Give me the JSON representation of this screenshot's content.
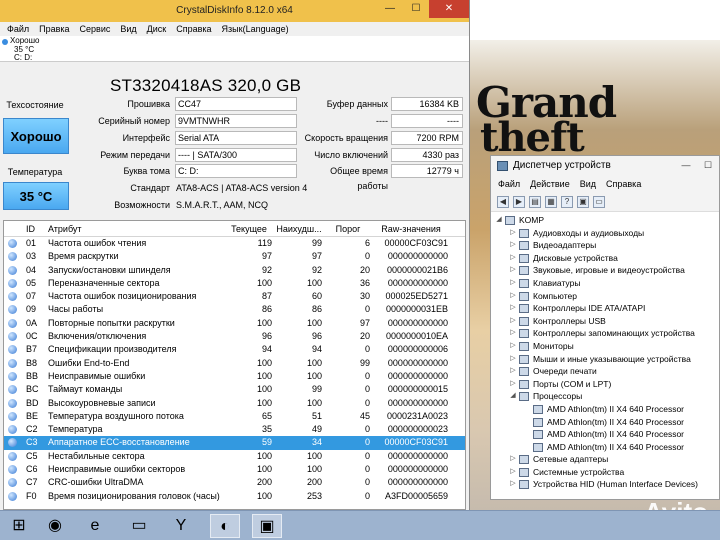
{
  "cdi": {
    "title": "CrystalDiskInfo 8.12.0 x64",
    "window_btns": {
      "min": "—",
      "max": "☐",
      "close": "✕"
    },
    "menu": [
      "Файл",
      "Правка",
      "Сервис",
      "Вид",
      "Диск",
      "Справка",
      "Язык(Language)"
    ],
    "drive_tab": {
      "status": "Хорошо",
      "temp": "35 °C",
      "letters": "C: D:"
    },
    "model": "ST3320418AS 320,0 GB",
    "health_label": "Техсостояние",
    "health_value": "Хорошо",
    "temp_label": "Температура",
    "temp_value": "35 °C",
    "info_left": [
      {
        "k": "Прошивка",
        "v": "CC47"
      },
      {
        "k": "Серийный номер",
        "v": "9VMTNWHR"
      },
      {
        "k": "Интерфейс",
        "v": "Serial ATA"
      },
      {
        "k": "Режим передачи",
        "v": "---- | SATA/300"
      },
      {
        "k": "Буква тома",
        "v": "C: D:"
      }
    ],
    "info_right": [
      {
        "k": "Буфер данных",
        "v": "16384 KB"
      },
      {
        "k": "----",
        "v": "----"
      },
      {
        "k": "Скорость вращения",
        "v": "7200 RPM"
      },
      {
        "k": "Число включений",
        "v": "4330 раз"
      },
      {
        "k": "Общее время работы",
        "v": "12779 ч"
      }
    ],
    "standard": {
      "k": "Стандарт",
      "v": "ATA8-ACS | ATA8-ACS version 4"
    },
    "features": {
      "k": "Возможности",
      "v": "S.M.A.R.T., AAM, NCQ"
    },
    "table": {
      "headers": [
        "ID",
        "Атрибут",
        "Текущее",
        "Наихудш...",
        "Порог",
        "Raw-значения"
      ],
      "rows": [
        [
          "01",
          "Частота ошибок чтения",
          "119",
          "99",
          "6",
          "00000CF03C91"
        ],
        [
          "03",
          "Время раскрутки",
          "97",
          "97",
          "0",
          "000000000000"
        ],
        [
          "04",
          "Запуски/остановки шпинделя",
          "92",
          "92",
          "20",
          "0000000021B6"
        ],
        [
          "05",
          "Переназначенные сектора",
          "100",
          "100",
          "36",
          "000000000000"
        ],
        [
          "07",
          "Частота ошибок позиционирования",
          "87",
          "60",
          "30",
          "000025ED5271"
        ],
        [
          "09",
          "Часы работы",
          "86",
          "86",
          "0",
          "0000000031EB"
        ],
        [
          "0A",
          "Повторные попытки раскрутки",
          "100",
          "100",
          "97",
          "000000000000"
        ],
        [
          "0C",
          "Включения/отключения",
          "96",
          "96",
          "20",
          "0000000010EA"
        ],
        [
          "B7",
          "Спецификации производителя",
          "94",
          "94",
          "0",
          "000000000006"
        ],
        [
          "B8",
          "Ошибки End-to-End",
          "100",
          "100",
          "99",
          "000000000000"
        ],
        [
          "BB",
          "Неисправимые ошибки",
          "100",
          "100",
          "0",
          "000000000000"
        ],
        [
          "BC",
          "Таймаут команды",
          "100",
          "99",
          "0",
          "000000000015"
        ],
        [
          "BD",
          "Высокоуровневые записи",
          "100",
          "100",
          "0",
          "000000000000"
        ],
        [
          "BE",
          "Температура воздушного потока",
          "65",
          "51",
          "45",
          "0000231A0023"
        ],
        [
          "C2",
          "Температура",
          "35",
          "49",
          "0",
          "000000000023"
        ],
        [
          "C3",
          "Аппаратное ECC-восстановление",
          "59",
          "34",
          "0",
          "00000CF03C91"
        ],
        [
          "C5",
          "Нестабильные сектора",
          "100",
          "100",
          "0",
          "000000000000"
        ],
        [
          "C6",
          "Неисправимые ошибки секторов",
          "100",
          "100",
          "0",
          "000000000000"
        ],
        [
          "C7",
          "CRC-ошибки UltraDMA",
          "200",
          "200",
          "0",
          "000000000000"
        ],
        [
          "F0",
          "Время позиционирования головок (часы)",
          "100",
          "253",
          "0",
          "A3FD00005659"
        ]
      ],
      "selected_row": 15
    }
  },
  "wallpaper": {
    "logo_line1": "Grand",
    "logo_line2": "theft",
    "watermark": "Avito"
  },
  "devmgr": {
    "title": "Диспетчер устройств",
    "menu": [
      "Файл",
      "Действие",
      "Вид",
      "Справка"
    ],
    "root": "KOMP",
    "categories": [
      "Аудиовходы и аудиовыходы",
      "Видеоадаптеры",
      "Дисковые устройства",
      "Звуковые, игровые и видеоустройства",
      "Клавиатуры",
      "Компьютер",
      "Контроллеры IDE ATA/ATAPI",
      "Контроллеры USB",
      "Контроллеры запоминающих устройства",
      "Мониторы",
      "Мыши и иные указывающие устройства",
      "Очереди печати",
      "Порты (COM и LPT)",
      "Процессоры"
    ],
    "processors": [
      "AMD Athlon(tm) II X4 640 Processor",
      "AMD Athlon(tm) II X4 640 Processor",
      "AMD Athlon(tm) II X4 640 Processor",
      "AMD Athlon(tm) II X4 640 Processor"
    ],
    "categories_after": [
      "Сетевые адаптеры",
      "Системные устройства",
      "Устройства HID (Human Interface Devices)"
    ]
  },
  "taskbar": {
    "items": [
      {
        "name": "start-icon",
        "glyph": "⊞"
      },
      {
        "name": "alice-icon",
        "glyph": "◉"
      },
      {
        "name": "ie-icon",
        "glyph": "e"
      },
      {
        "name": "explorer-icon",
        "glyph": "▭"
      },
      {
        "name": "yandex-icon",
        "glyph": "Y"
      },
      {
        "name": "crystaldiskinfo-icon",
        "glyph": "◐"
      },
      {
        "name": "devmgr-icon",
        "glyph": "▣"
      }
    ]
  }
}
